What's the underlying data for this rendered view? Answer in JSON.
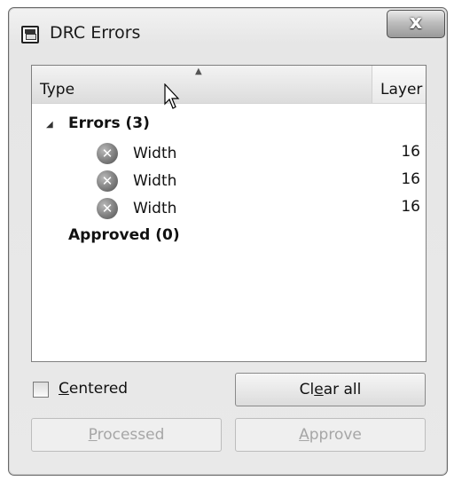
{
  "window": {
    "title": "DRC Errors",
    "icon": "floppy-disk-icon",
    "close_glyph": "x"
  },
  "list": {
    "columns": {
      "type": "Type",
      "layer": "Layer"
    },
    "sort_indicator": "▲",
    "groups": [
      {
        "label": "Errors (3)",
        "expanded": true,
        "items": [
          {
            "type": "Width",
            "layer": "16",
            "icon": "error-x-icon"
          },
          {
            "type": "Width",
            "layer": "16",
            "icon": "error-x-icon"
          },
          {
            "type": "Width",
            "layer": "16",
            "icon": "error-x-icon"
          }
        ]
      },
      {
        "label": "Approved (0)",
        "expanded": false,
        "items": []
      }
    ]
  },
  "options": {
    "centered": {
      "label": "Centered",
      "checked": false
    }
  },
  "buttons": {
    "clear_all": {
      "label": "Clear all",
      "enabled": true
    },
    "processed": {
      "label": "Processed",
      "enabled": false
    },
    "approve": {
      "label": "Approve",
      "enabled": false
    }
  }
}
